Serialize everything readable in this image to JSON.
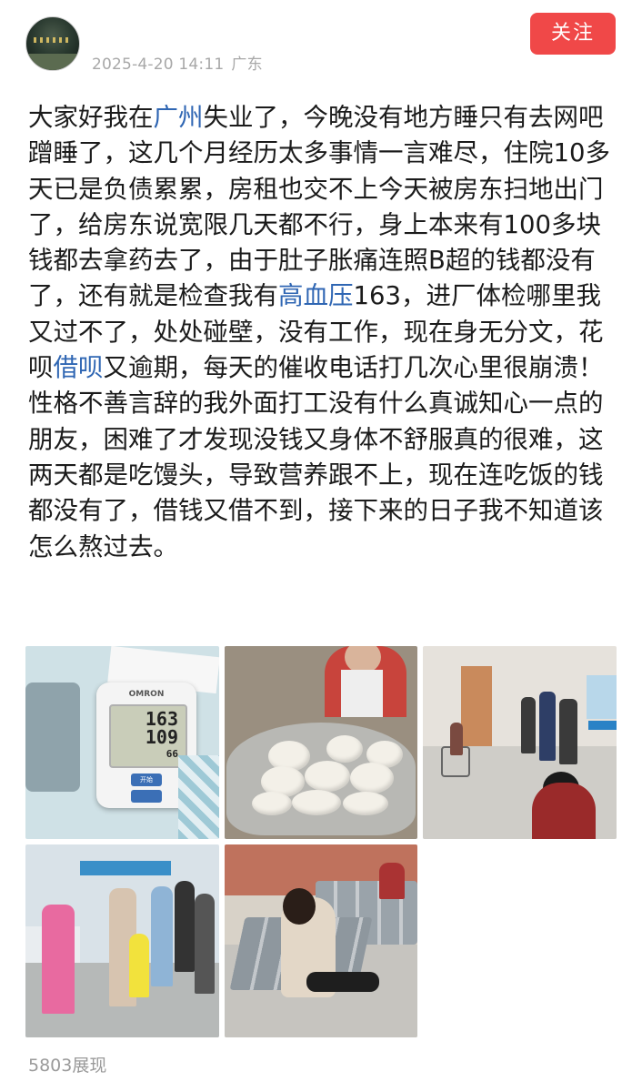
{
  "header": {
    "date": "2025-4-20 14:11",
    "location": "广东",
    "follow_label": "关注"
  },
  "post": {
    "segments": [
      {
        "text": "大家好我在",
        "link": false
      },
      {
        "text": "广州",
        "link": true
      },
      {
        "text": "失业了，今晚没有地方睡只有去网吧蹭睡了，这几个月经历太多事情一言难尽，住院10多天已是负债累累，房租也交不上今天被房东扫地出门了，给房东说宽限几天都不行，身上本来有100多块钱都去拿药去了，由于肚子胀痛连照B超的钱都没有了，还有就是检查我有",
        "link": false
      },
      {
        "text": "高血压",
        "link": true
      },
      {
        "text": "163，进厂体检哪里我又过不了，处处碰壁，没有工作，现在身无分文，花呗",
        "link": false
      },
      {
        "text": "借呗",
        "link": true
      },
      {
        "text": "又逾期，每天的催收电话打几次心里很崩溃！性格不善言辞的我外面打工没有什么真诚知心一点的朋友，困难了才发现没钱又身体不舒服真的很难，这两天都是吃馒头，导致营养跟不上，现在连吃饭的钱都没有了，借钱又借不到，接下来的日子我不知道该怎么熬过去。",
        "link": false
      }
    ]
  },
  "photos": {
    "bp_monitor": {
      "brand": "OMRON",
      "systolic": "163",
      "diastolic": "109",
      "pulse": "66",
      "button": "开始"
    }
  },
  "footer": {
    "views": "5803展现"
  },
  "colors": {
    "follow_bg": "#f04848",
    "link": "#2f66b3",
    "meta": "#a8a8a8"
  }
}
